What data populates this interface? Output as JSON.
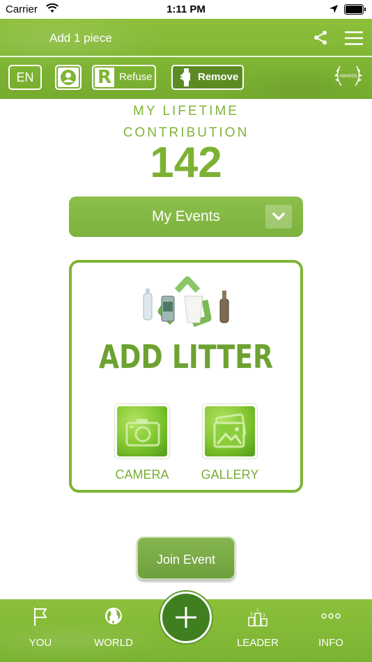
{
  "status_bar": {
    "carrier": "Carrier",
    "time": "1:11 PM"
  },
  "header": {
    "title": "Add 1 piece",
    "language": "EN",
    "refuse_label": "Refuse",
    "refuse_letter": "R",
    "remove_label": "Remove",
    "awards_text": "AWARDS"
  },
  "contribution": {
    "line1": "MY LIFETIME",
    "line2": "CONTRIBUTION",
    "count": "142"
  },
  "events": {
    "label": "My Events"
  },
  "add_litter": {
    "title": "ADD LITTER",
    "camera_label": "CAMERA",
    "gallery_label": "GALLERY"
  },
  "join_event": {
    "label": "Join Event"
  },
  "tabbar": {
    "you": "YOU",
    "world": "WORLD",
    "leader": "LEADER",
    "info": "INFO"
  },
  "colors": {
    "brand_green": "#7fb534",
    "dark_green": "#3f7f1f",
    "text_green": "#7cb233"
  },
  "icons": [
    "wifi-icon",
    "location-icon",
    "battery-icon",
    "share-icon",
    "menu-icon",
    "profile-icon",
    "remove-hand-icon",
    "awards-laurel-icon",
    "chevron-down-icon",
    "recycle-icon",
    "camera-icon",
    "gallery-icon",
    "flag-icon",
    "globe-icon",
    "plus-icon",
    "podium-icon",
    "dots-icon"
  ]
}
